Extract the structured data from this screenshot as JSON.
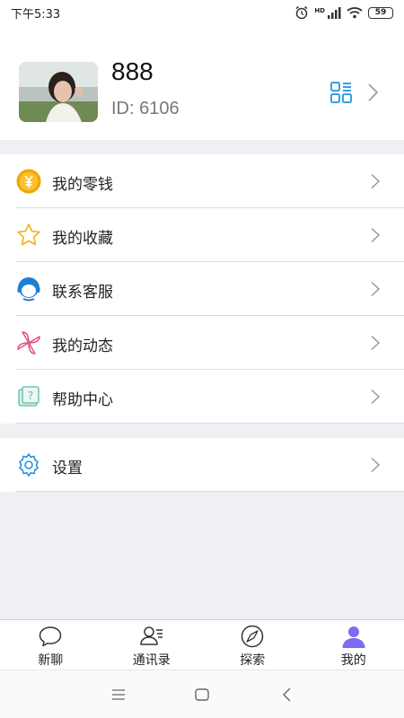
{
  "status": {
    "time": "下午5:33",
    "battery": "59",
    "hd": "HD"
  },
  "profile": {
    "name": "888",
    "id_label": "ID: 6106"
  },
  "menu": {
    "group1": [
      {
        "label": "我的零钱",
        "icon": "yuan-coin-icon"
      },
      {
        "label": "我的收藏",
        "icon": "star-icon"
      },
      {
        "label": "联系客服",
        "icon": "customer-service-icon"
      },
      {
        "label": "我的动态",
        "icon": "pinwheel-icon"
      },
      {
        "label": "帮助中心",
        "icon": "help-icon"
      }
    ],
    "group2": [
      {
        "label": "设置",
        "icon": "settings-gear-icon"
      }
    ]
  },
  "tabs": [
    {
      "label": "新聊",
      "icon": "chat-bubble-icon",
      "active": false
    },
    {
      "label": "通讯录",
      "icon": "contacts-icon",
      "active": false
    },
    {
      "label": "探索",
      "icon": "compass-icon",
      "active": false
    },
    {
      "label": "我的",
      "icon": "person-icon",
      "active": true
    }
  ],
  "colors": {
    "accent": "#3aa0e0",
    "coin": "#f0a500",
    "pinwheel": "#e0517a",
    "person_active": "#7b6cf0",
    "background": "#efeff4"
  }
}
